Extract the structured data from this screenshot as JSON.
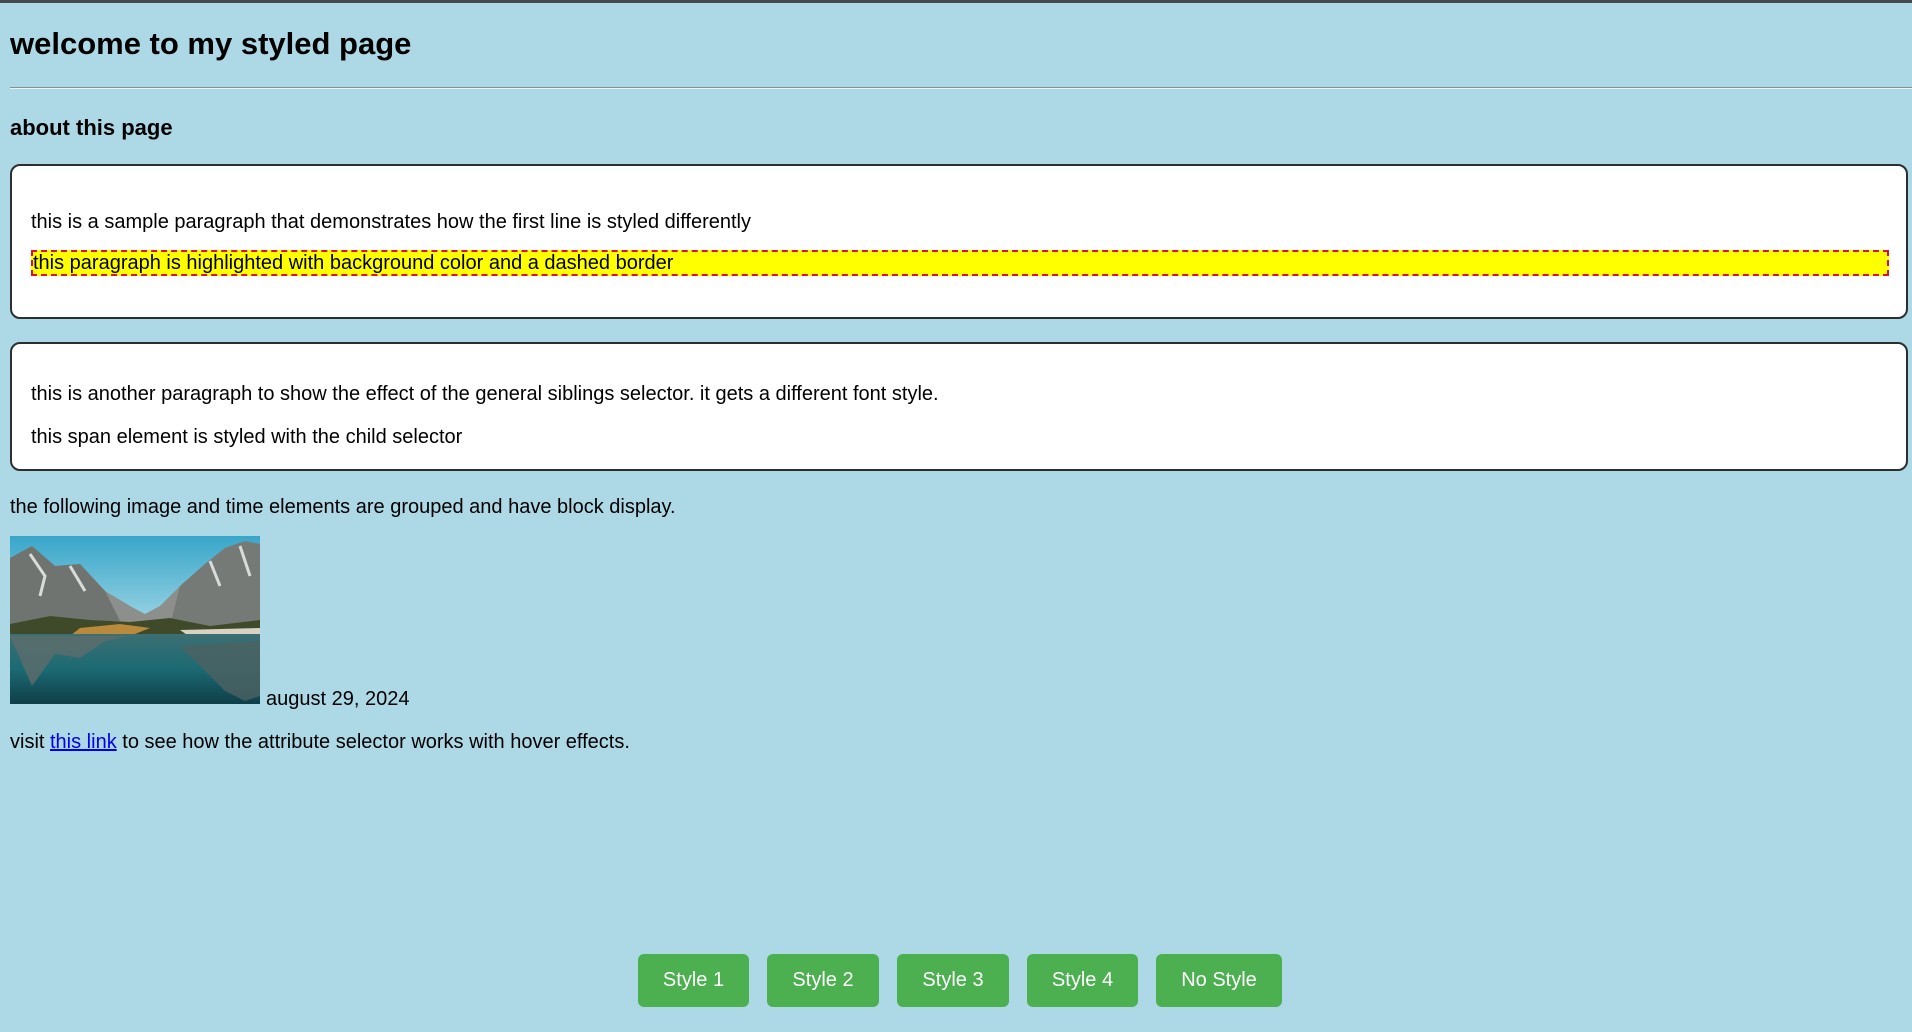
{
  "header": {
    "title": "welcome to my styled page",
    "subtitle": "about this page"
  },
  "card1": {
    "first_paragraph": "this is a sample paragraph that demonstrates how the first line is styled differently",
    "highlight_paragraph": "this paragraph is highlighted with background color and a dashed border"
  },
  "card2": {
    "paragraph": "this is another paragraph to show the effect of the general siblings selector. it gets a different font style.",
    "span_text": "this span element is styled with the child selector"
  },
  "media": {
    "intro": "the following image and time elements are grouped and have block display.",
    "image_icon": "mountain-lake-photo",
    "date": "august 29, 2024"
  },
  "link_line": {
    "prefix": "visit ",
    "link_text": "this link",
    "suffix": " to see how the attribute selector works with hover effects."
  },
  "buttons": {
    "style1": "Style 1",
    "style2": "Style 2",
    "style3": "Style 3",
    "style4": "Style 4",
    "no_style": "No Style"
  },
  "colors": {
    "background": "#add8e6",
    "highlight_bg": "#ffff00",
    "highlight_border": "#e0102a",
    "button": "#4caf50",
    "link": "#0000ee"
  }
}
